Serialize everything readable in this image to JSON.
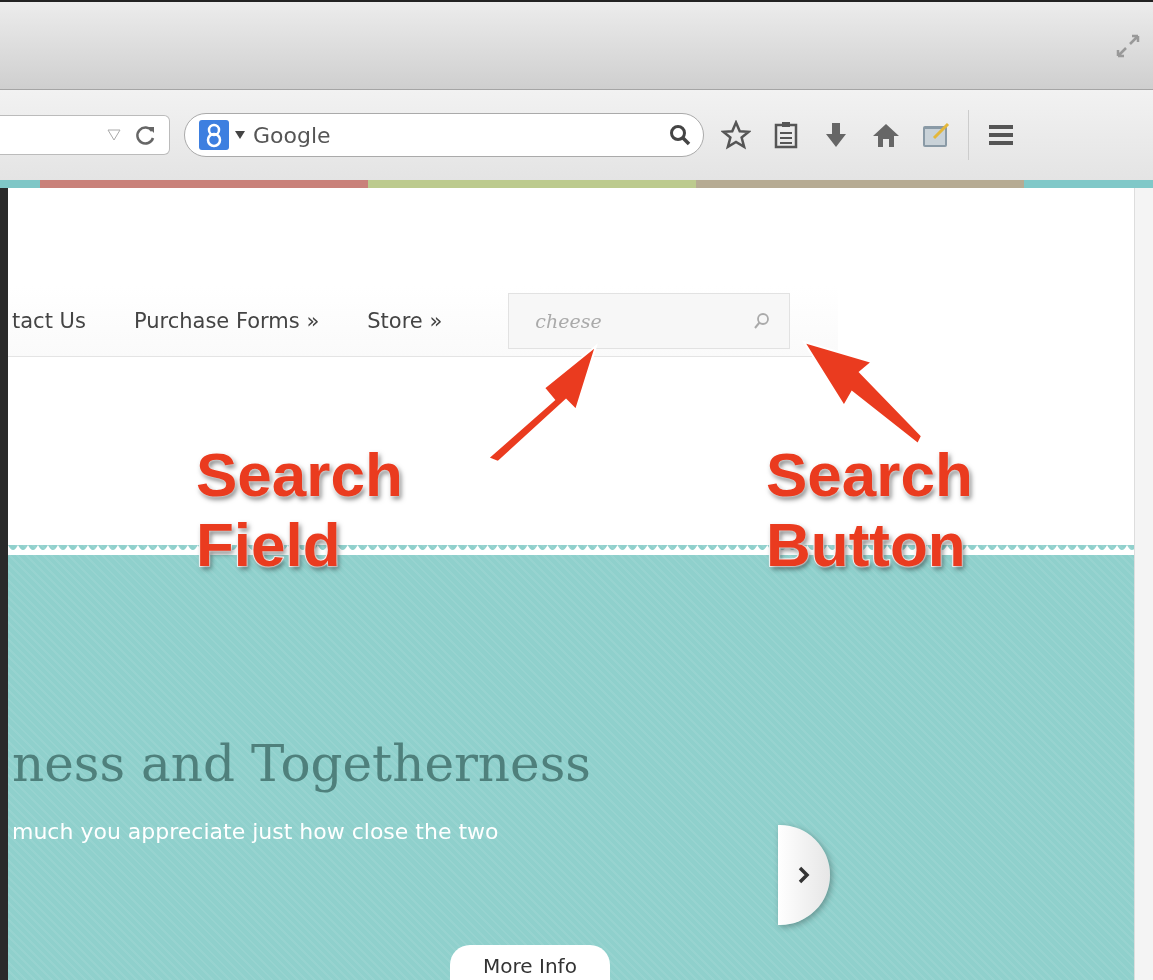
{
  "browser": {
    "search_placeholder": "Google"
  },
  "nav": {
    "items": [
      "tact Us",
      "Purchase Forms »",
      "Store »"
    ]
  },
  "search": {
    "value": "cheese"
  },
  "annotations": [
    {
      "lines": [
        "Search",
        "Field"
      ]
    },
    {
      "lines": [
        "Search",
        "Button"
      ]
    }
  ],
  "hero": {
    "heading": "ness and Togetherness",
    "text": "much you appreciate just how close the two",
    "button": "More Info"
  }
}
